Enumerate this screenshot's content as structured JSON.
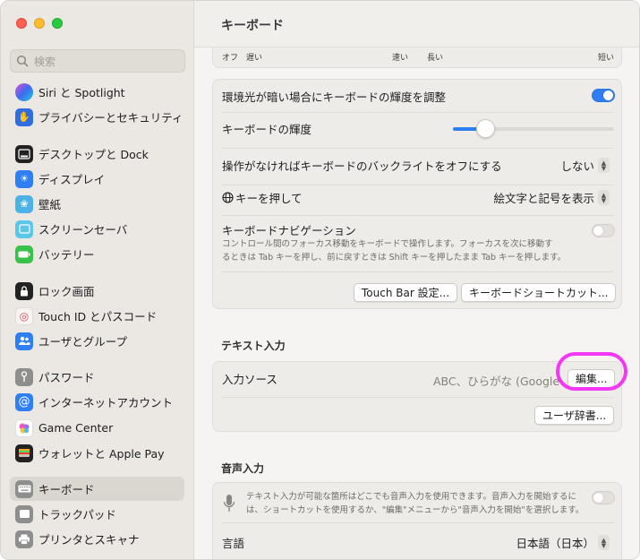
{
  "window": {
    "title": "キーボード"
  },
  "sidebar": {
    "search_placeholder": "検索",
    "items": [
      {
        "label": "Siri と Spotlight",
        "icon": "siri-icon",
        "color": "#6b4bd8"
      },
      {
        "label": "プライバシーとセキュリティ",
        "icon": "hand-icon",
        "color": "#2f6de0"
      },
      {
        "label": "デスクトップと Dock",
        "icon": "dock-icon",
        "color": "#222222"
      },
      {
        "label": "ディスプレイ",
        "icon": "display-icon",
        "color": "#2f7ff2"
      },
      {
        "label": "壁紙",
        "icon": "wallpaper-icon",
        "color": "#4ab2e6"
      },
      {
        "label": "スクリーンセーバ",
        "icon": "screensaver-icon",
        "color": "#5ac6e8"
      },
      {
        "label": "バッテリー",
        "icon": "battery-icon",
        "color": "#38c24a"
      },
      {
        "label": "ロック画面",
        "icon": "lock-icon",
        "color": "#222222"
      },
      {
        "label": "Touch ID とパスコード",
        "icon": "fingerprint-icon",
        "color": "#f4f1ee"
      },
      {
        "label": "ユーザとグループ",
        "icon": "users-icon",
        "color": "#2f7ff2"
      },
      {
        "label": "パスワード",
        "icon": "key-icon",
        "color": "#8e8e8e"
      },
      {
        "label": "インターネットアカウント",
        "icon": "at-icon",
        "color": "#2f7ff2"
      },
      {
        "label": "Game Center",
        "icon": "game-center-icon",
        "color": "#ffffff"
      },
      {
        "label": "ウォレットと Apple Pay",
        "icon": "wallet-icon",
        "color": "#222222"
      },
      {
        "label": "キーボード",
        "icon": "keyboard-icon",
        "color": "#8e8e8e"
      },
      {
        "label": "トラックパッド",
        "icon": "trackpad-icon",
        "color": "#8e8e8e"
      },
      {
        "label": "プリンタとスキャナ",
        "icon": "printer-icon",
        "color": "#8e8e8e"
      }
    ]
  },
  "main": {
    "slider_labels": {
      "off": "オフ",
      "slow": "遅い",
      "fast": "速い",
      "long": "長い",
      "short": "短い"
    },
    "keyboard_settings": {
      "adjust_brightness_label": "環境光が暗い場合にキーボードの輝度を調整",
      "adjust_brightness_on": true,
      "brightness_label": "キーボードの輝度",
      "brightness_value": 0.2,
      "backlight_off_label": "操作がなければキーボードのバックライトをオフにする",
      "backlight_off_value": "しない",
      "globe_key_label": "キーを押して",
      "globe_key_value": "絵文字と記号を表示",
      "nav_label": "キーボードナビゲーション",
      "nav_desc_1": "コントロール間のフォーカス移動をキーボードで操作します。フォーカスを次に移動す",
      "nav_desc_2": "るときは Tab キーを押し、前に戻すときは Shift キーを押したまま Tab キーを押します。",
      "nav_on": false,
      "touchbar_button": "Touch Bar 設定...",
      "shortcuts_button": "キーボードショートカット..."
    },
    "text_input": {
      "section_title": "テキスト入力",
      "input_sources_label": "入力ソース",
      "input_sources_value": "ABC、ひらがな (Google",
      "edit_button": "編集...",
      "user_dict_button": "ユーザ辞書..."
    },
    "dictation": {
      "section_title": "音声入力",
      "desc_1": "テキスト入力が可能な箇所はどこでも音声入力を使用できます。音声入力を開始するに",
      "desc_2": "は、ショートカットを使用するか、\"編集\"メニューから\"音声入力を開始\"を選択します。",
      "enabled": false,
      "language_label": "言語",
      "language_value": "日本語（日本）"
    }
  },
  "colors": {
    "accent": "#2f7ff2",
    "highlight": "#f238f2"
  }
}
